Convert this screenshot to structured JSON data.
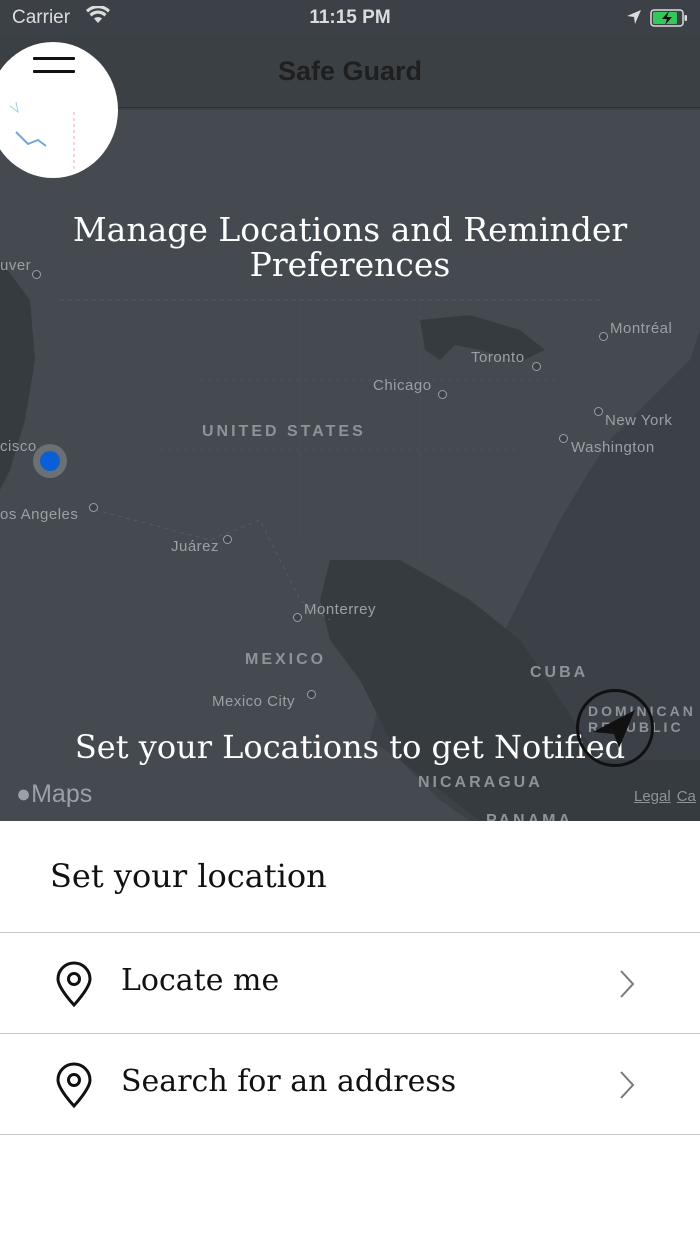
{
  "status_bar": {
    "carrier": "Carrier",
    "time": "11:15 PM",
    "icons": [
      "wifi-icon",
      "location-arrow-icon",
      "battery-charging-icon"
    ]
  },
  "nav": {
    "title": "Safe Guard",
    "menu_icon": "hamburger-menu-icon"
  },
  "map": {
    "title": "Manage Locations and Reminder Preferences",
    "subtitle": "Set your Locations to get Notified",
    "labels": {
      "vancouver": "uver",
      "montreal": "Montréal",
      "toronto": "Toronto",
      "chicago": "Chicago",
      "united_states": "UNITED STATES",
      "new_york": "New York",
      "washington": "Washington",
      "san_francisco": "cisco",
      "los_angeles": "os Angeles",
      "juarez": "Juárez",
      "monterrey": "Monterrey",
      "mexico": "MEXICO",
      "cuba": "CUBA",
      "mexico_city": "Mexico City",
      "dominican_republic": "DOMINICAN REPUBLIC",
      "nicaragua": "NICARAGUA",
      "panama": "PANAMA"
    },
    "attribution": "Maps",
    "legal": "Legal",
    "legal_suffix": "Ca"
  },
  "sheet": {
    "heading": "Set your location",
    "rows": [
      {
        "label": "Locate me",
        "icon": "location-pin-icon"
      },
      {
        "label": "Search for an address",
        "icon": "location-pin-icon"
      }
    ]
  },
  "colors": {
    "map_bg": "#3b4146",
    "user_location": "#0a5fd6",
    "battery": "#34c759"
  }
}
